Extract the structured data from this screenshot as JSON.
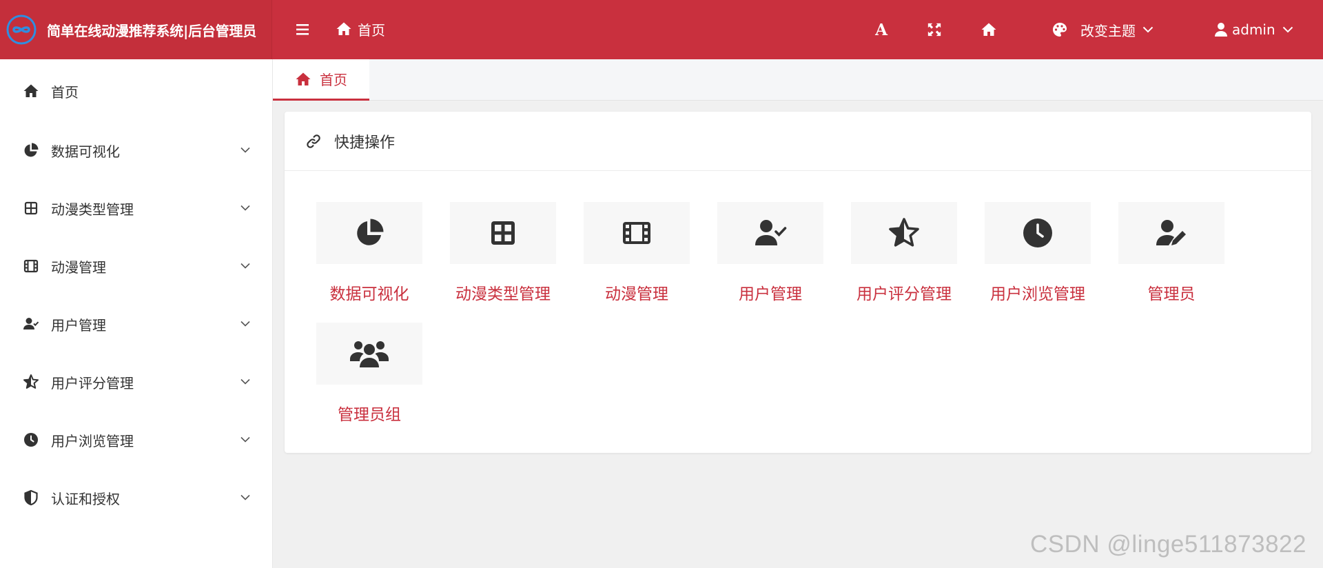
{
  "header": {
    "app_title": "简单在线动漫推荐系统|后台管理员",
    "breadcrumb": "首页",
    "theme_label": "改变主题",
    "user_label": "admin",
    "font_button": "A",
    "accent_color": "#c9303e"
  },
  "sidebar": {
    "items": [
      {
        "label": "首页",
        "icon": "home-icon",
        "expandable": false
      },
      {
        "label": "数据可视化",
        "icon": "chart-pie-icon",
        "expandable": true
      },
      {
        "label": "动漫类型管理",
        "icon": "grid-icon",
        "expandable": true
      },
      {
        "label": "动漫管理",
        "icon": "film-icon",
        "expandable": true
      },
      {
        "label": "用户管理",
        "icon": "user-check-icon",
        "expandable": true
      },
      {
        "label": "用户评分管理",
        "icon": "star-half-icon",
        "expandable": true
      },
      {
        "label": "用户浏览管理",
        "icon": "clock-icon",
        "expandable": true
      },
      {
        "label": "认证和授权",
        "icon": "shield-icon",
        "expandable": true
      }
    ]
  },
  "tabs": [
    {
      "label": "首页",
      "active": true
    }
  ],
  "quick_actions": {
    "title": "快捷操作",
    "items": [
      {
        "label": "数据可视化",
        "icon": "chart-pie-icon"
      },
      {
        "label": "动漫类型管理",
        "icon": "grid-icon"
      },
      {
        "label": "动漫管理",
        "icon": "film-icon"
      },
      {
        "label": "用户管理",
        "icon": "user-check-icon"
      },
      {
        "label": "用户评分管理",
        "icon": "star-half-icon"
      },
      {
        "label": "用户浏览管理",
        "icon": "clock-icon"
      },
      {
        "label": "管理员",
        "icon": "user-edit-icon"
      },
      {
        "label": "管理员组",
        "icon": "users-icon"
      }
    ]
  },
  "watermark": "CSDN @linge511873822"
}
